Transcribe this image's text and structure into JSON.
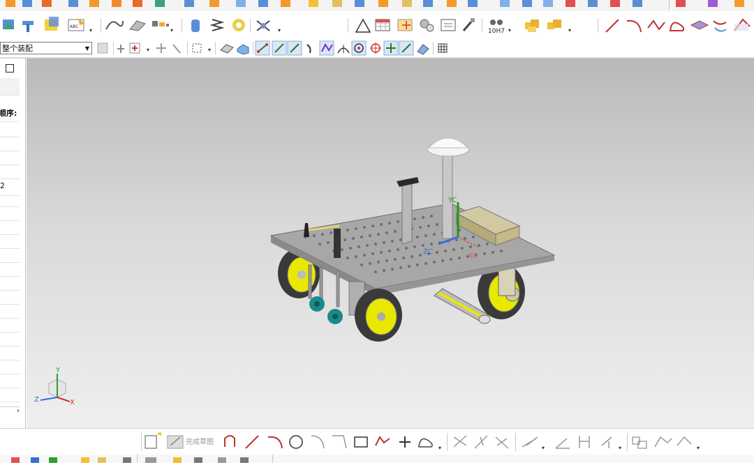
{
  "assembly_scope": {
    "value": "整个装配"
  },
  "left_panel": {
    "order_label": "顺序:",
    "row_value": "2",
    "scroll_right": "›"
  },
  "viewport": {
    "axis_labels": {
      "yc": "YC",
      "zc": "ZC",
      "xc": "XC"
    },
    "triad_labels": {
      "y": "Y",
      "z": "Z",
      "x": "X"
    }
  },
  "sketch_toolbar": {
    "finish_sketch_label": "完成草图"
  },
  "toolbar_misc": {
    "tolerance_label": "10H7"
  },
  "colors": {
    "viewport_top": "#b9b9b9",
    "viewport_bottom": "#efefef",
    "wheel_yellow": "#e8e800",
    "plate_grey": "#a7a7a7"
  }
}
